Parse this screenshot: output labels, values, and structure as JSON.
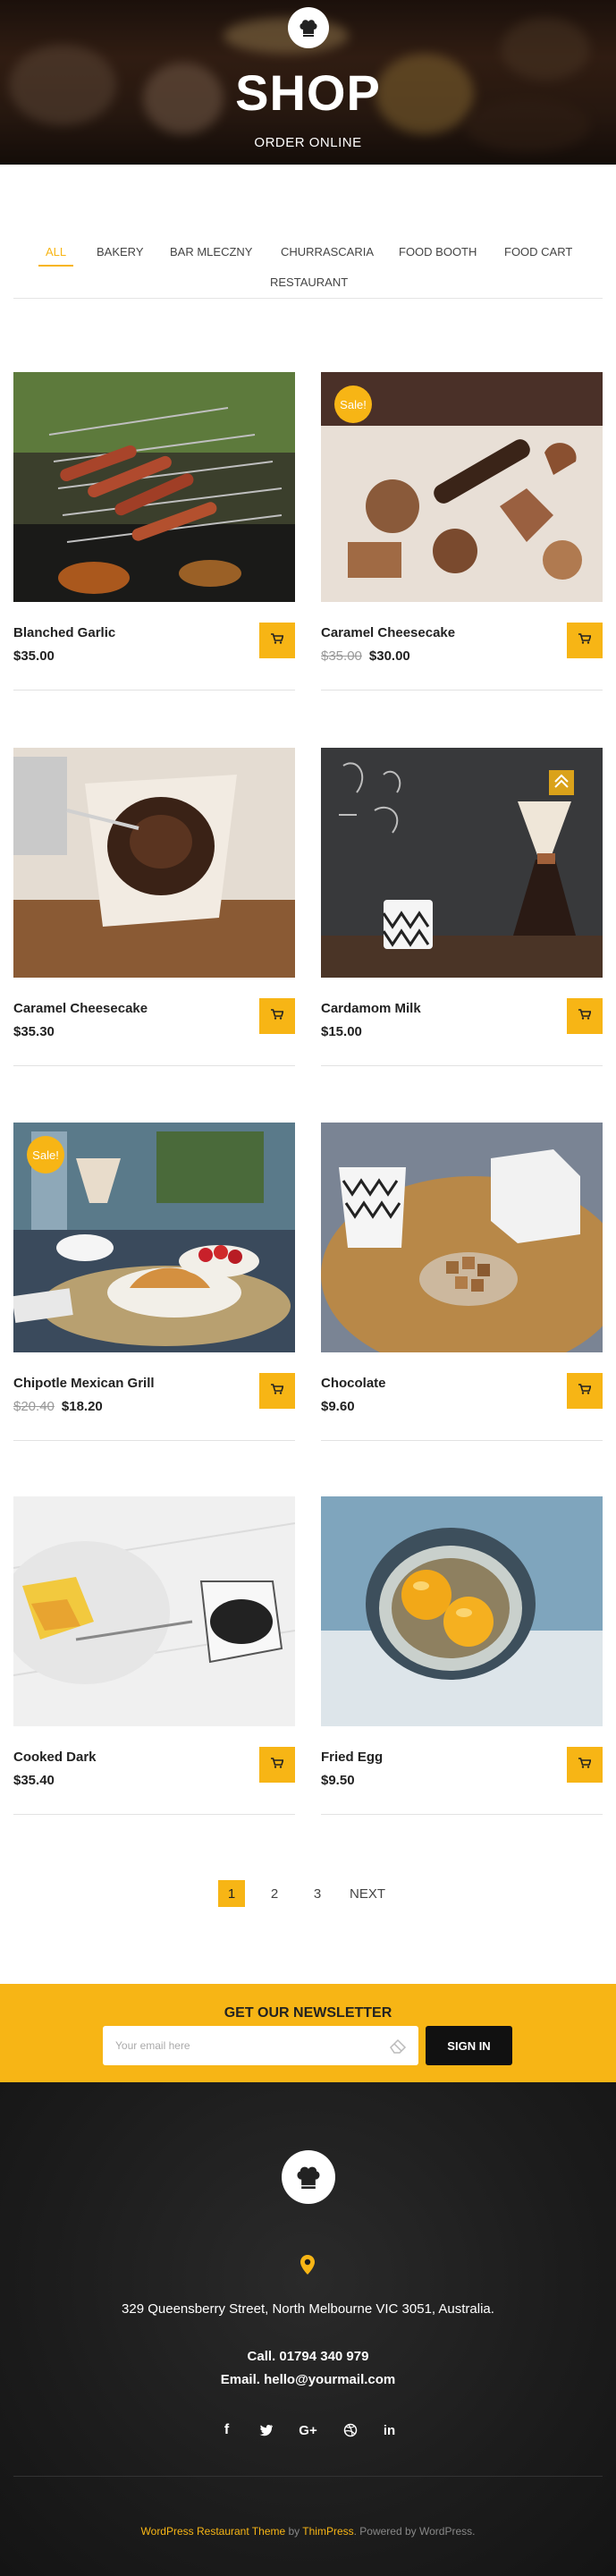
{
  "hero": {
    "title": "SHOP",
    "subtitle": "ORDER ONLINE"
  },
  "filters": [
    "ALL",
    "BAKERY",
    "BAR MLECZNY",
    "CHURRASCARIA",
    "FOOD BOOTH",
    "FOOD CART",
    "RESTAURANT"
  ],
  "products": [
    {
      "name": "Blanched Garlic",
      "price": "$35.00",
      "old_price": "",
      "sale": ""
    },
    {
      "name": "Caramel Cheesecake",
      "price": "$30.00",
      "old_price": "$35.00",
      "sale": "Sale!"
    },
    {
      "name": "Caramel Cheesecake",
      "price": "$35.30",
      "old_price": "",
      "sale": ""
    },
    {
      "name": "Cardamom Milk",
      "price": "$15.00",
      "old_price": "",
      "sale": ""
    },
    {
      "name": "Chipotle Mexican Grill",
      "price": "$18.20",
      "old_price": "$20.40",
      "sale": "Sale!"
    },
    {
      "name": "Chocolate",
      "price": "$9.60",
      "old_price": "",
      "sale": ""
    },
    {
      "name": "Cooked Dark",
      "price": "$35.40",
      "old_price": "",
      "sale": ""
    },
    {
      "name": "Fried Egg",
      "price": "$9.50",
      "old_price": "",
      "sale": ""
    }
  ],
  "pagination": {
    "pages": [
      "1",
      "2",
      "3"
    ],
    "next": "NEXT"
  },
  "newsletter": {
    "title": "GET OUR NEWSLETTER",
    "placeholder": "Your email here",
    "button": "SIGN IN"
  },
  "footer": {
    "address": "329 Queensberry Street, North Melbourne VIC 3051, Australia.",
    "call": "Call. 01794 340 979",
    "email": "Email. hello@yourmail.com",
    "social": [
      "facebook-icon",
      "twitter-icon",
      "google-plus-icon",
      "dribbble-icon",
      "linkedin-icon"
    ],
    "credit_link": "WordPress Restaurant Theme",
    "credit_by": " by ",
    "credit_brand": "ThimPress",
    "credit_tail": ". Powered by WordPress."
  },
  "colors": {
    "accent": "#f7b515",
    "footer_bg": "#1c1c1c"
  }
}
